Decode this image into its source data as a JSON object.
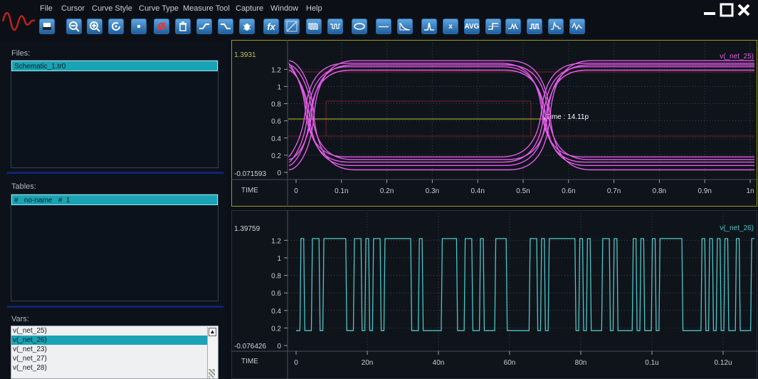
{
  "menu": [
    "File",
    "Cursor",
    "Curve Style",
    "Curve Type",
    "Measure Tool",
    "Capture",
    "Window",
    "Help"
  ],
  "toolbar": [
    {
      "name": "print-icon",
      "label": ""
    },
    {
      "name": "zoom-out-icon",
      "label": ""
    },
    {
      "name": "zoom-in-icon",
      "label": ""
    },
    {
      "name": "zoom-reset-icon",
      "label": ""
    },
    {
      "name": "stop-icon",
      "label": ""
    },
    {
      "name": "no-measure-icon",
      "label": ""
    },
    {
      "name": "trash-icon",
      "label": ""
    },
    {
      "name": "rising-edge-icon",
      "label": ""
    },
    {
      "name": "falling-edge-icon",
      "label": ""
    },
    {
      "name": "bug-icon",
      "label": ""
    },
    {
      "name": "function-icon",
      "label": "fx"
    },
    {
      "name": "line-chart-icon",
      "label": ""
    },
    {
      "name": "pulse-train-icon",
      "label": ""
    },
    {
      "name": "eye-pattern-icon",
      "label": ""
    },
    {
      "name": "eye-shape-icon",
      "label": ""
    },
    {
      "name": "noise-icon",
      "label": ""
    },
    {
      "name": "decay-icon",
      "label": ""
    },
    {
      "name": "peak-icon",
      "label": ""
    },
    {
      "name": "x-marker-icon",
      "label": "x"
    },
    {
      "name": "average-icon",
      "label": "AVG"
    },
    {
      "name": "step-icon",
      "label": ""
    },
    {
      "name": "edge-detect-icon",
      "label": ""
    },
    {
      "name": "square-wave-icon",
      "label": ""
    },
    {
      "name": "overshoot-icon",
      "label": ""
    },
    {
      "name": "waveform-arrow-icon",
      "label": ""
    }
  ],
  "files": {
    "label": "Files:",
    "items": [
      "Schematic_1.tr0"
    ]
  },
  "tables": {
    "label": "Tables:",
    "items": [
      "#   no-name   #  1"
    ]
  },
  "vars": {
    "label": "Vars:",
    "items": [
      "v(_net_25)",
      "v(_net_26)",
      "v(_net_23)",
      "v(_net_27)",
      "v(_net_28)"
    ],
    "selected": 1
  },
  "plot1": {
    "signal": "v(_net_25)",
    "ymax_label": "1.3931",
    "ymin_label": "-0.071593",
    "yticks": [
      "1.2",
      "1",
      "0.8",
      "0.6",
      "0.4",
      "0.2",
      "0"
    ],
    "xlabel": "TIME",
    "xticks": [
      "0",
      "0.1n",
      "0.2n",
      "0.3n",
      "0.4n",
      "0.5n",
      "0.6n",
      "0.7n",
      "0.8n",
      "0.9n",
      "1n"
    ],
    "cursor": "Time : 14.11p",
    "color": "#e25be8"
  },
  "plot2": {
    "signal": "v(_net_26)",
    "ymax_label": "1.39759",
    "ymin_label": "-0.076426",
    "yticks": [
      "1.2",
      "1",
      "0.8",
      "0.6",
      "0.4",
      "0.2",
      "0"
    ],
    "xlabel": "TIME",
    "xticks": [
      "0",
      "20n",
      "40n",
      "60n",
      "80n",
      "0.1u",
      "0.12u"
    ],
    "color": "#4fc6c6"
  }
}
